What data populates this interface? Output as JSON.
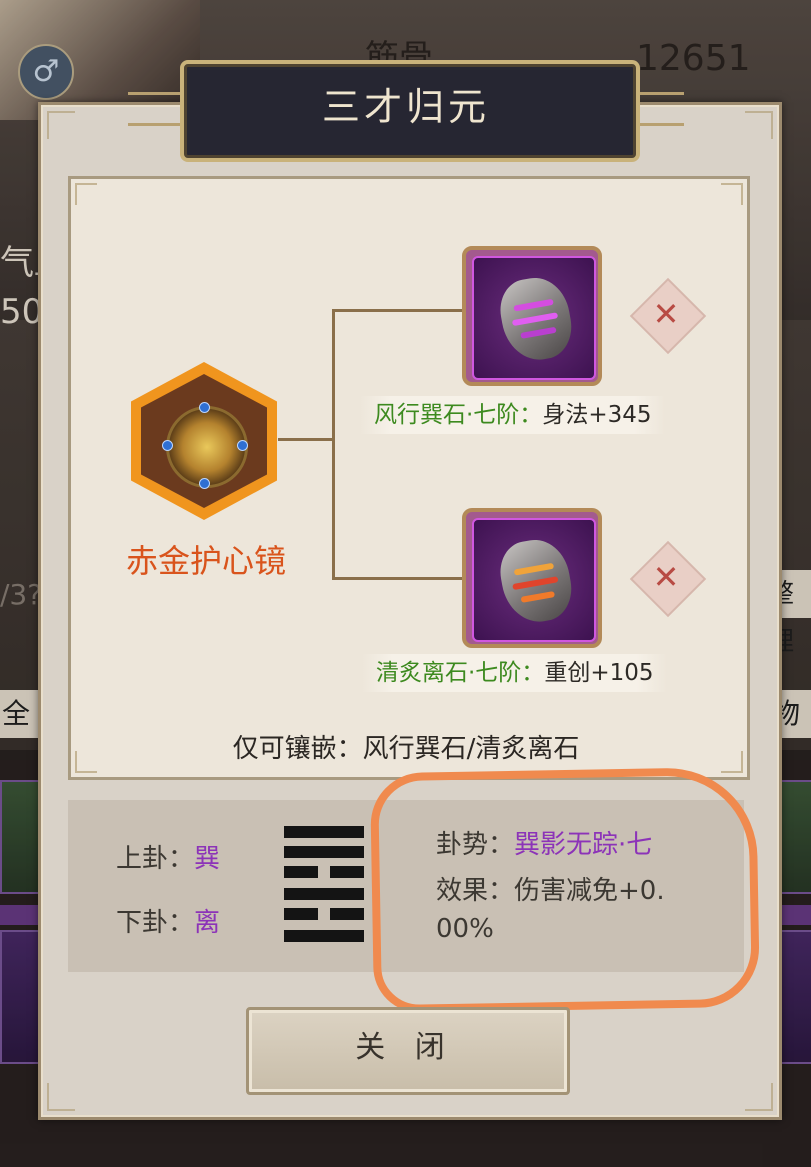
{
  "background": {
    "label_partial": "筋骨",
    "number": "12651",
    "qi_partial": "气血",
    "value_partial": "50",
    "slash_partial": "/3?",
    "tidy_partial": "整理",
    "tab_left_partial": "全",
    "tab_right_partial": "物",
    "gender_symbol": "♂"
  },
  "dialog": {
    "title": "三才归元",
    "main_item": {
      "name": "赤金护心镜",
      "icon": "mirror-icon"
    },
    "slots": [
      {
        "label_name": "风行巽石·七阶：",
        "label_stat": "身法+345",
        "icon": "wind-stone-icon",
        "remove_icon": "✕"
      },
      {
        "label_name": "清炙离石·七阶：",
        "label_stat": "重创+105",
        "icon": "fire-stone-icon",
        "remove_icon": "✕"
      }
    ],
    "only_embed": "仅可镶嵌：风行巽石/清炙离石",
    "trigram": {
      "upper_label": "上卦：",
      "upper_value": "巽",
      "lower_label": "下卦：",
      "lower_value": "离",
      "hexagram_icon": "hexagram-icon"
    },
    "effect": {
      "trend_label": "卦势：",
      "trend_value": "巽影无踪·七",
      "effect_label": "效果：",
      "effect_value_line1": "伤害减免+0.",
      "effect_value_line2": "00%"
    },
    "close_button": "关 闭"
  },
  "colors": {
    "accent_orange": "#d9541c",
    "trigram_purple": "#8c33b8",
    "stat_green": "#3d8a1f",
    "highlight_orange": "#f08a4e"
  }
}
